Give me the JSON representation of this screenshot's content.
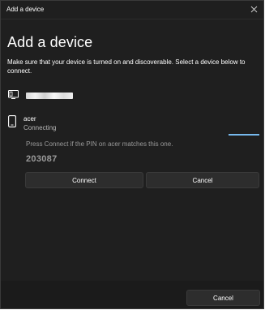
{
  "window": {
    "title": "Add a device",
    "close_icon": "close-icon"
  },
  "heading": "Add a device",
  "instructions": "Make sure that your device is turned on and discoverable. Select a device below to connect.",
  "devices": [
    {
      "icon": "display-icon",
      "name": "",
      "status": "",
      "name_redacted": true
    },
    {
      "icon": "phone-icon",
      "name": "acer",
      "status": "Connecting",
      "progress": 1.0
    }
  ],
  "pin_prompt": {
    "message": "Press Connect if the PIN on  acer  matches this one.",
    "pin": "203087",
    "connect_label": "Connect",
    "cancel_label": "Cancel"
  },
  "footer": {
    "cancel_label": "Cancel"
  },
  "colors": {
    "background": "#1f1f1f",
    "button": "#2d2d2d",
    "accent": "#76b9ed",
    "muted_text": "#9a9a9a"
  }
}
